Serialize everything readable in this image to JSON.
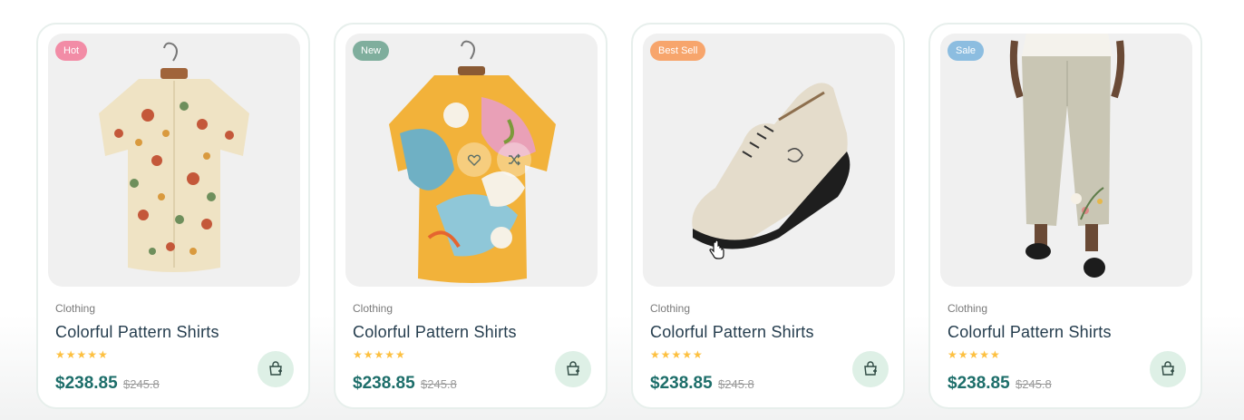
{
  "products": [
    {
      "badge": "Hot",
      "badge_color": "#f74b81",
      "category": "Clothing",
      "title": "Colorful Pattern Shirts",
      "rating": 5,
      "stars": "★★★★★",
      "price": "$238.85",
      "old_price": "$245.8",
      "image": "mushroom-print-shirt"
    },
    {
      "badge": "New",
      "badge_color": "#67bcae",
      "category": "Clothing",
      "title": "Colorful Pattern Shirts",
      "rating": 5,
      "stars": "★★★★★",
      "price": "$238.85",
      "old_price": "$245.8",
      "image": "abstract-print-shirt"
    },
    {
      "badge": "Best Sell",
      "badge_color": "#f59758",
      "category": "Clothing",
      "title": "Colorful Pattern Shirts",
      "rating": 5,
      "stars": "★★★★★",
      "price": "$238.85",
      "old_price": "$245.8",
      "image": "canvas-sneaker"
    },
    {
      "badge": "Sale",
      "badge_color": "#3bb3ea",
      "category": "Clothing",
      "title": "Colorful Pattern Shirts",
      "rating": 5,
      "stars": "★★★★★",
      "price": "$238.85",
      "old_price": "$245.8",
      "image": "linen-pants"
    }
  ],
  "icons": {
    "cart": "add-to-cart-icon",
    "wishlist": "heart-icon",
    "compare": "shuffle-icon"
  },
  "colors": {
    "price": "#1d6e6a",
    "title": "#253d4e",
    "star": "#fdc040",
    "cart_bg": "#def0e6"
  }
}
